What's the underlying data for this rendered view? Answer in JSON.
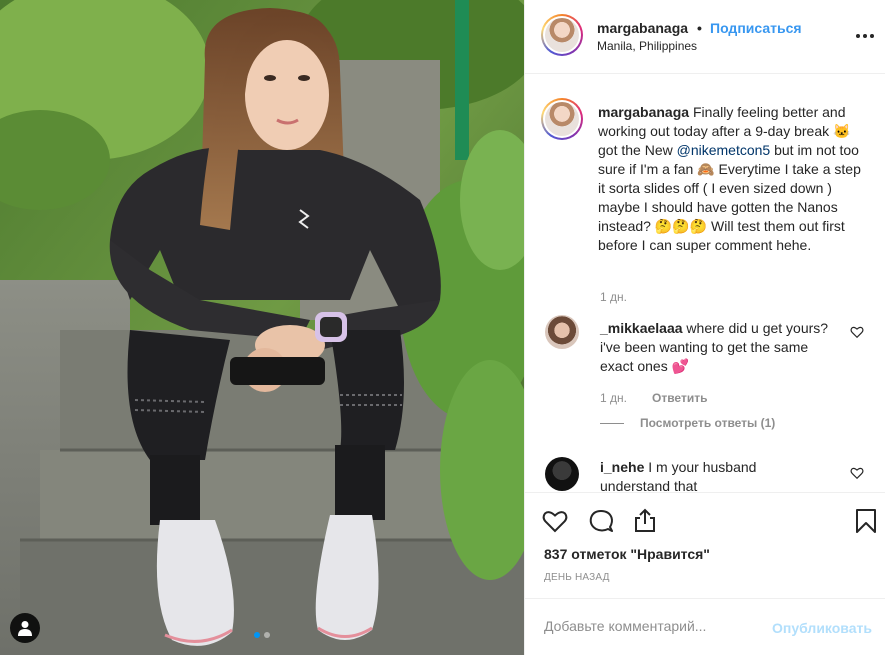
{
  "header": {
    "username": "margabanaga",
    "separator": "•",
    "follow_label": "Подписаться",
    "location": "Manila, Philippines"
  },
  "caption": {
    "username": "margabanaga",
    "text_before_mention": "Finally feeling better and working out today after a 9-day break 🐱 got the New",
    "mention": "@nikemetcon5",
    "text_after_mention": "but im not too sure if I'm a fan 🙈 Everytime I take a step it sorta slides off ( I even sized down ) maybe I should have gotten the Nanos instead? 🤔🤔🤔 Will test them out first before I can super comment hehe.",
    "time": "1 дн."
  },
  "comments": [
    {
      "username": "_mikkaelaaa",
      "text": "where did u get yours? i've been wanting to get the same exact ones 💕",
      "time": "1 дн.",
      "reply_label": "Ответить",
      "view_replies_label": "Посмотреть ответы (1)"
    },
    {
      "username": "i_nehe",
      "text": "I m your husband understand that"
    }
  ],
  "actions": {
    "likes_text": "837 отметок \"Нравится\"",
    "date_text": "ДЕНЬ НАЗАД"
  },
  "add_comment": {
    "placeholder": "Добавьте комментарий...",
    "publish_label": "Опубликовать"
  },
  "carousel": {
    "current": 1,
    "total": 2
  },
  "colors": {
    "accent": "#3897f0",
    "publish_disabled": "#b2dffc",
    "muted": "#8e8e8e"
  },
  "icons": [
    "user-tag-icon",
    "more-options-icon",
    "heart-icon",
    "comment-icon",
    "share-icon",
    "bookmark-icon",
    "like-comment-icon"
  ]
}
